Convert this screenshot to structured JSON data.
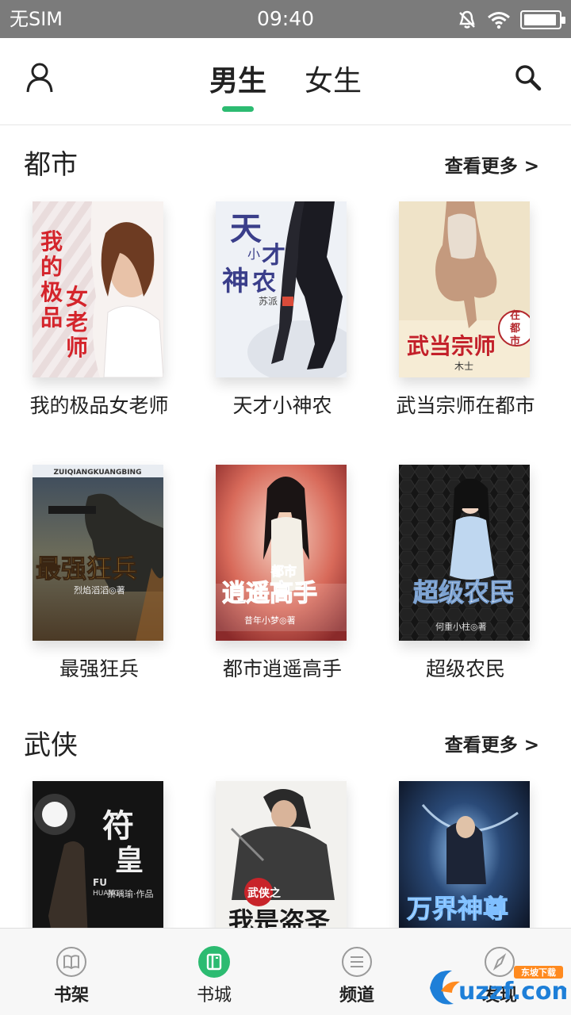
{
  "status_bar": {
    "carrier": "无SIM",
    "time": "09:40",
    "battery_level": 0.95
  },
  "header": {
    "user_icon": "user-icon",
    "search_icon": "search-icon",
    "tabs": [
      {
        "label": "男生",
        "active": true
      },
      {
        "label": "女生",
        "active": false
      }
    ],
    "accent_color": "#2cbb71"
  },
  "sections": [
    {
      "title": "都市",
      "more_label": "查看更多 >",
      "books": [
        {
          "title": "我的极品女老师",
          "cover_text": "我的极品女老师"
        },
        {
          "title": "天才小神农",
          "cover_text": "天才小神农",
          "cover_author": "苏派"
        },
        {
          "title": "武当宗师在都市",
          "cover_text": "武当宗师在都市",
          "cover_author": "木士"
        },
        {
          "title": "最强狂兵",
          "cover_text": "最强狂兵",
          "cover_subtitle": "ZUIQIANGKUANGBING"
        },
        {
          "title": "都市逍遥高手",
          "cover_text": "都市逍遥高手"
        },
        {
          "title": "超级农民",
          "cover_text": "超级农民"
        }
      ]
    },
    {
      "title": "武侠",
      "more_label": "查看更多 >",
      "books": [
        {
          "title": "",
          "cover_text": "符皇",
          "cover_subtitle": "FU HUANG"
        },
        {
          "title": "",
          "cover_text": "我是盗圣",
          "cover_badge": "武侠之"
        },
        {
          "title": "",
          "cover_text": "万界神尊"
        }
      ]
    }
  ],
  "bottom_nav": [
    {
      "label": "书架",
      "icon": "book-icon",
      "active": false
    },
    {
      "label": "书城",
      "icon": "bookstore-icon",
      "active": true
    },
    {
      "label": "频道",
      "icon": "list-icon",
      "active": false
    },
    {
      "label": "发现",
      "icon": "compass-icon",
      "active": false
    }
  ],
  "watermark": {
    "text": "uzzf.com",
    "sub": "东坡下载"
  }
}
